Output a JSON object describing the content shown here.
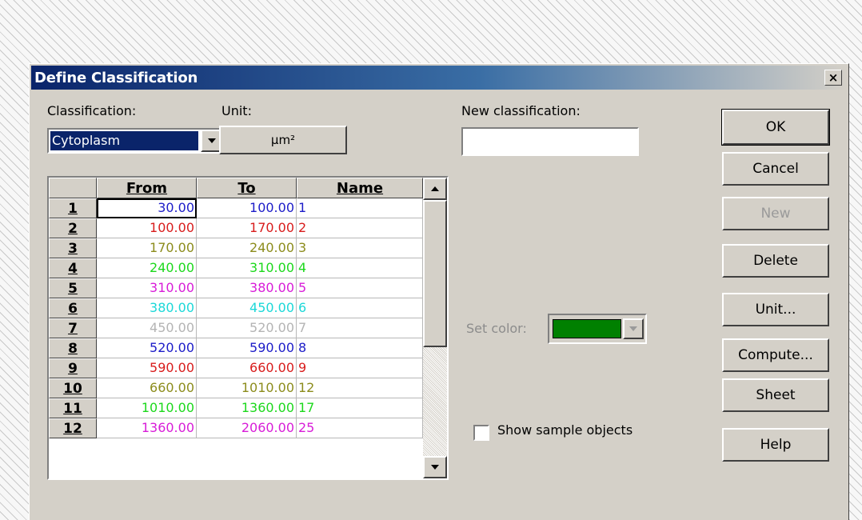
{
  "dialog": {
    "title": "Define Classification",
    "close_label": "×"
  },
  "classification": {
    "label": "Classification:",
    "selected": "Cytoplasm"
  },
  "unit": {
    "label": "Unit:",
    "value": "µm²"
  },
  "new_classification": {
    "label": "New classification:",
    "value": ""
  },
  "table": {
    "headers": [
      "",
      "From",
      "To",
      "Name"
    ],
    "rows": [
      {
        "num": "1",
        "from": "30.00",
        "to": "100.00",
        "name": "1",
        "color": "#1c1cc8"
      },
      {
        "num": "2",
        "from": "100.00",
        "to": "170.00",
        "name": "2",
        "color": "#d81c1c"
      },
      {
        "num": "3",
        "from": "170.00",
        "to": "240.00",
        "name": "3",
        "color": "#8c8c1c"
      },
      {
        "num": "4",
        "from": "240.00",
        "to": "310.00",
        "name": "4",
        "color": "#1cd81c"
      },
      {
        "num": "5",
        "from": "310.00",
        "to": "380.00",
        "name": "5",
        "color": "#d81cd8"
      },
      {
        "num": "6",
        "from": "380.00",
        "to": "450.00",
        "name": "6",
        "color": "#1cd8d8"
      },
      {
        "num": "7",
        "from": "450.00",
        "to": "520.00",
        "name": "7",
        "color": "#b4b4b4"
      },
      {
        "num": "8",
        "from": "520.00",
        "to": "590.00",
        "name": "8",
        "color": "#1c1cc8"
      },
      {
        "num": "9",
        "from": "590.00",
        "to": "660.00",
        "name": "9",
        "color": "#d81c1c"
      },
      {
        "num": "10",
        "from": "660.00",
        "to": "1010.00",
        "name": "12",
        "color": "#8c8c1c"
      },
      {
        "num": "11",
        "from": "1010.00",
        "to": "1360.00",
        "name": "17",
        "color": "#1cd81c"
      },
      {
        "num": "12",
        "from": "1360.00",
        "to": "2060.00",
        "name": "25",
        "color": "#d81cd8"
      }
    ]
  },
  "set_color": {
    "label": "Set color:",
    "color": "#008000"
  },
  "show_sample": {
    "label": "Show sample objects",
    "checked": false
  },
  "buttons": {
    "ok": "OK",
    "cancel": "Cancel",
    "new": "New",
    "delete": "Delete",
    "unit": "Unit...",
    "compute": "Compute...",
    "sheet": "Sheet",
    "help": "Help"
  }
}
